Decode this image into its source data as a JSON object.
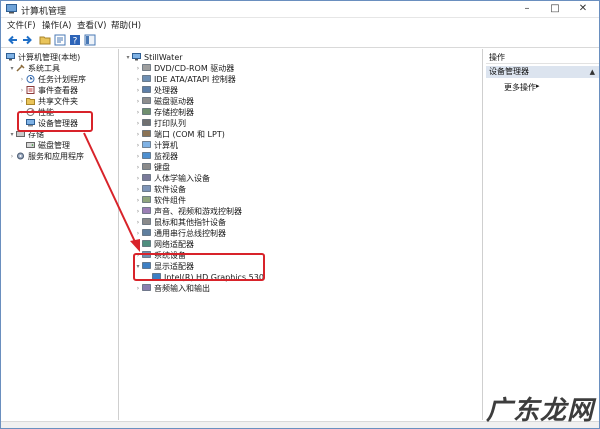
{
  "window": {
    "title": "计算机管理"
  },
  "menu": [
    "文件(F)",
    "操作(A)",
    "查看(V)",
    "帮助(H)"
  ],
  "toolbar": [
    "back-arrow-icon",
    "forward-arrow-icon",
    "folder-icon",
    "properties-icon",
    "help-icon",
    "console-icon"
  ],
  "left_tree": [
    {
      "label": "计算机管理(本地)",
      "icon": "computer-icon",
      "arrow": ""
    },
    {
      "label": "系统工具",
      "icon": "tools-icon",
      "arrow": "▾"
    },
    {
      "label": "任务计划程序",
      "icon": "clock-icon",
      "arrow": "›"
    },
    {
      "label": "事件查看器",
      "icon": "event-icon",
      "arrow": "›"
    },
    {
      "label": "共享文件夹",
      "icon": "shared-folder-icon",
      "arrow": "›"
    },
    {
      "label": "性能",
      "icon": "performance-icon",
      "arrow": "›"
    },
    {
      "label": "设备管理器",
      "icon": "device-manager-icon",
      "arrow": ""
    },
    {
      "label": "存储",
      "icon": "storage-icon",
      "arrow": "▾"
    },
    {
      "label": "磁盘管理",
      "icon": "disk-icon",
      "arrow": ""
    },
    {
      "label": "服务和应用程序",
      "icon": "services-icon",
      "arrow": "›"
    }
  ],
  "device_tree": {
    "root": "StillWater",
    "items": [
      {
        "label": "DVD/CD-ROM 驱动器",
        "icon": "dvd-icon",
        "arrow": "›"
      },
      {
        "label": "IDE ATA/ATAPI 控制器",
        "icon": "ide-controller-icon",
        "arrow": "›"
      },
      {
        "label": "处理器",
        "icon": "processor-icon",
        "arrow": "›"
      },
      {
        "label": "磁盘驱动器",
        "icon": "disk-drive-icon",
        "arrow": "›"
      },
      {
        "label": "存储控制器",
        "icon": "storage-controller-icon",
        "arrow": "›"
      },
      {
        "label": "打印队列",
        "icon": "printer-icon",
        "arrow": "›"
      },
      {
        "label": "端口 (COM 和 LPT)",
        "icon": "port-icon",
        "arrow": "›"
      },
      {
        "label": "计算机",
        "icon": "computer-icon",
        "arrow": "›"
      },
      {
        "label": "监视器",
        "icon": "monitor-icon",
        "arrow": "›"
      },
      {
        "label": "键盘",
        "icon": "keyboard-icon",
        "arrow": "›"
      },
      {
        "label": "人体学输入设备",
        "icon": "hid-icon",
        "arrow": "›"
      },
      {
        "label": "软件设备",
        "icon": "software-device-icon",
        "arrow": "›"
      },
      {
        "label": "软件组件",
        "icon": "software-component-icon",
        "arrow": "›"
      },
      {
        "label": "声音、视频和游戏控制器",
        "icon": "sound-icon",
        "arrow": "›"
      },
      {
        "label": "鼠标和其他指针设备",
        "icon": "mouse-icon",
        "arrow": "›"
      },
      {
        "label": "通用串行总线控制器",
        "icon": "usb-icon",
        "arrow": "›"
      },
      {
        "label": "网络适配器",
        "icon": "network-icon",
        "arrow": "›"
      },
      {
        "label": "系统设备",
        "icon": "system-device-icon",
        "arrow": "›"
      },
      {
        "label": "显示适配器",
        "icon": "display-adapter-icon",
        "arrow": "▾"
      },
      {
        "label": "Intel(R) HD Graphics 530",
        "icon": "display-adapter-icon",
        "arrow": "",
        "child": true
      },
      {
        "label": "音频输入和输出",
        "icon": "audio-io-icon",
        "arrow": "›"
      }
    ]
  },
  "actions": {
    "header": "操作",
    "selected": "设备管理器",
    "more": "更多操作"
  },
  "watermark": "广东龙网",
  "colors": {
    "annotation": "#d8232a",
    "selection": "#dce4ef"
  }
}
